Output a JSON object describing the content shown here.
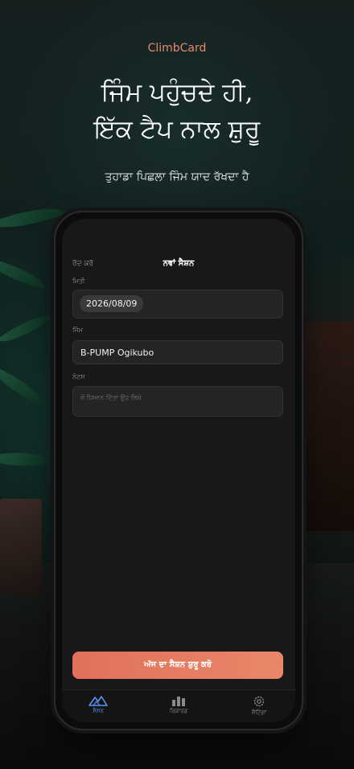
{
  "hero": {
    "brand": "ClimbCard",
    "headline_line1": "ਜਿੰਮ ਪਹੁੰਚਦੇ ਹੀ,",
    "headline_line2": "ਇੱਕ ਟੈਪ ਨਾਲ ਸ਼ੁਰੂ",
    "subtitle": "ਤੁਹਾਡਾ ਪਿਛਲਾ ਜਿੰਮ ਯਾਦ ਰੱਖਦਾ ਹੈ"
  },
  "app": {
    "header": {
      "cancel_label": "ਰੱਦ ਕਰੋ",
      "title": "ਨਵਾਂ ਸੈਸ਼ਨ"
    },
    "form": {
      "date_label": "ਮਿਤੀ",
      "date_value": "2026/08/09",
      "gym_label": "ਜਿੰਮ",
      "gym_value": "B-PUMP Ogikubo",
      "notes_label": "ਨੋਟਸ",
      "notes_placeholder": "ਜੋ ਧਿਆਨ ਦਿੱਤਾ ਉਹ ਲਿਖੋ"
    },
    "start_button": "ਅੱਜ ਦਾ ਸੈਸ਼ਨ ਸ਼ੁਰੂ ਕਰੋ",
    "tabs": [
      {
        "label": "ਸੈਸ਼ਨ",
        "icon": "mountain-icon",
        "active": true
      },
      {
        "label": "ਰਿਕਾਰਡ",
        "icon": "bar-chart-icon",
        "active": false
      },
      {
        "label": "ਸੈਟਿੰਗਾਂ",
        "icon": "gear-icon",
        "active": false
      }
    ]
  },
  "colors": {
    "accent": "#e9876a",
    "active_tab": "#5b8ff0"
  }
}
